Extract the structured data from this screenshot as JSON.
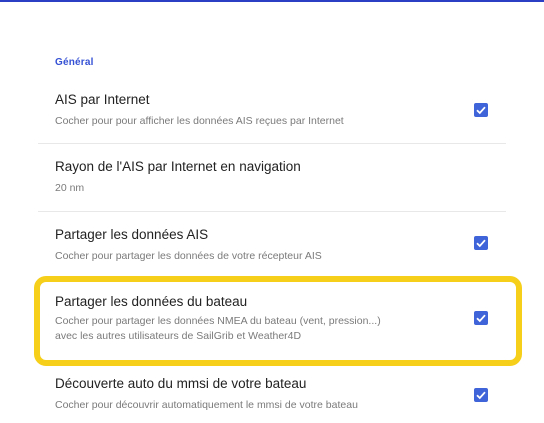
{
  "section": {
    "title": "Général"
  },
  "settings": [
    {
      "title": "AIS par Internet",
      "summary": [
        "Cocher pour pour afficher les données AIS reçues par Internet"
      ],
      "checked": true
    },
    {
      "title": "Rayon de l'AIS par Internet en navigation",
      "summary": [
        "20 nm"
      ],
      "checked": null
    },
    {
      "title": "Partager les données AIS",
      "summary": [
        "Cocher pour partager les données de votre récepteur AIS"
      ],
      "checked": true
    },
    {
      "title": "Partager les données du bateau",
      "summary": [
        "Cocher pour partager les données NMEA du bateau (vent, pression...)",
        "avec les autres utilisateurs de SailGrib et Weather4D"
      ],
      "checked": true,
      "highlighted": true
    },
    {
      "title": "Découverte auto du mmsi de votre bateau",
      "summary": [
        "Cocher pour découvrir automatiquement le mmsi de votre bateau"
      ],
      "checked": true
    }
  ],
  "colors": {
    "accent": "#3f63d8",
    "section_title": "#3450d4",
    "highlight": "#f5cf1a",
    "top_bar": "#2b3fc4"
  },
  "icons": {
    "checkbox_checked": "check-icon"
  }
}
